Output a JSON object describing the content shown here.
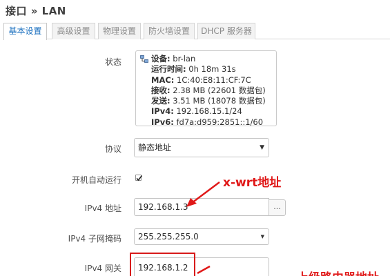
{
  "page": {
    "title": "接口 » LAN"
  },
  "tabs": [
    {
      "label": "基本设置",
      "active": true
    },
    {
      "label": "高级设置",
      "active": false
    },
    {
      "label": "物理设置",
      "active": false
    },
    {
      "label": "防火墙设置",
      "active": false
    },
    {
      "label": "DHCP 服务器",
      "active": false
    }
  ],
  "status": {
    "label": "状态",
    "device_key": "设备:",
    "device_val": "br-lan",
    "uptime_key": "运行时间:",
    "uptime_val": "0h 18m 31s",
    "mac_key": "MAC:",
    "mac_val": "1C:40:E8:11:CF:7C",
    "rx_key": "接收:",
    "rx_val": "2.38 MB (22601 数据包)",
    "tx_key": "发送:",
    "tx_val": "3.51 MB (18078 数据包)",
    "ipv4_key": "IPv4:",
    "ipv4_val": "192.168.15.1/24",
    "ipv6_key": "IPv6:",
    "ipv6_val": "fd7a:d959:2851::1/60"
  },
  "protocol": {
    "label": "协议",
    "value": "静态地址"
  },
  "autostart": {
    "label": "开机自动运行",
    "checked": true
  },
  "ipv4_address": {
    "label": "IPv4 地址",
    "value": "192.168.1.3",
    "more_button": "..."
  },
  "ipv4_netmask": {
    "label": "IPv4 子网掩码",
    "value": "255.255.255.0"
  },
  "ipv4_gateway": {
    "label": "IPv4 网关",
    "value": "192.168.1.2"
  },
  "annotations": {
    "xwrt_address": "x-wrt地址",
    "partial_text": "上级路由器地址"
  },
  "colors": {
    "active_tab": "#1a6fbf",
    "annotation_red": "#e01818"
  }
}
